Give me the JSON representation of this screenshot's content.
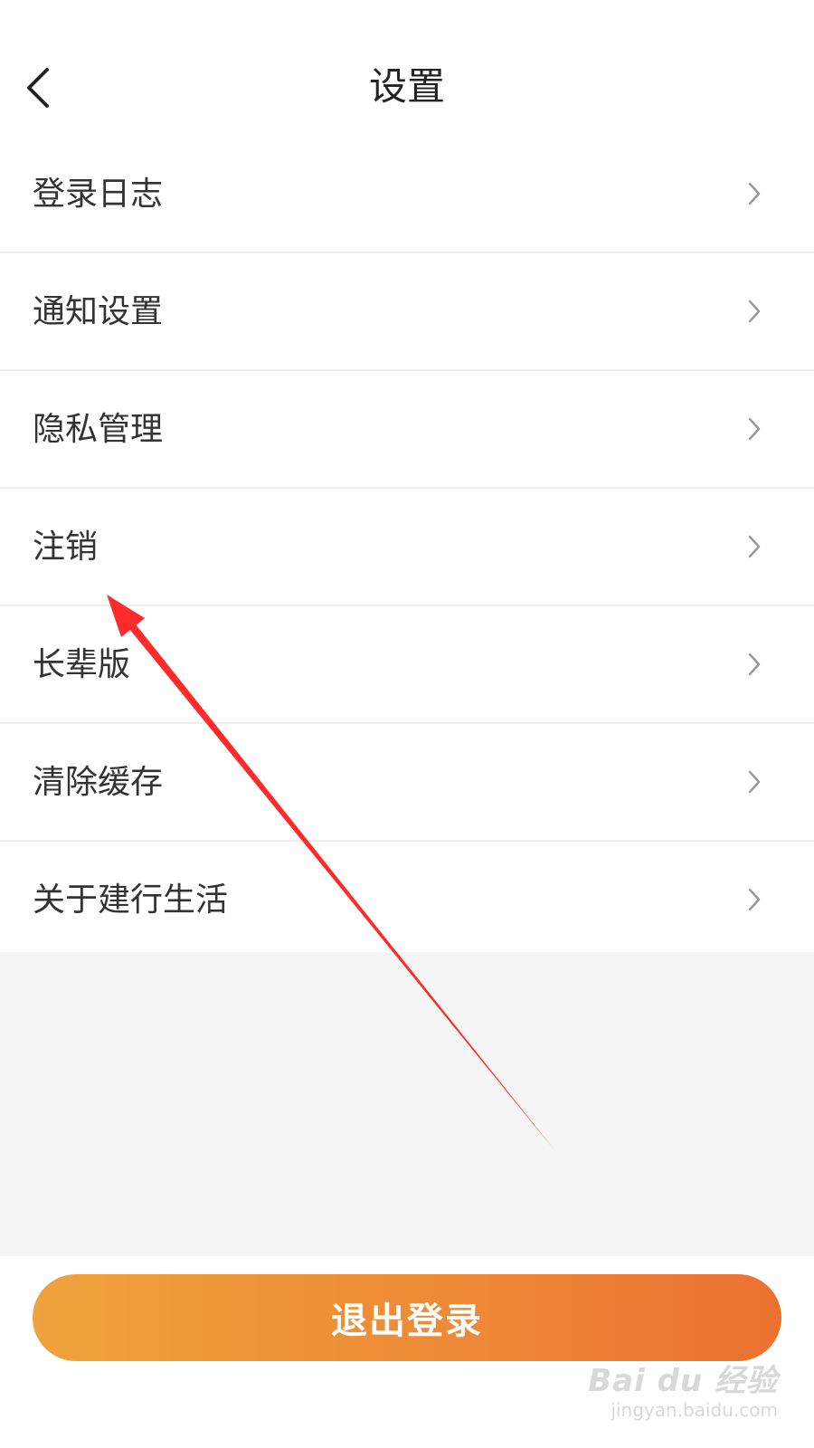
{
  "header": {
    "title": "设置",
    "back_icon": "chevron-left-icon"
  },
  "menu": {
    "items": [
      {
        "label": "登录日志",
        "icon": "chevron-right-icon"
      },
      {
        "label": "通知设置",
        "icon": "chevron-right-icon"
      },
      {
        "label": "隐私管理",
        "icon": "chevron-right-icon"
      },
      {
        "label": "注销",
        "icon": "chevron-right-icon"
      },
      {
        "label": "长辈版",
        "icon": "chevron-right-icon"
      },
      {
        "label": "清除缓存",
        "icon": "chevron-right-icon"
      },
      {
        "label": "关于建行生活",
        "icon": "chevron-right-icon"
      }
    ]
  },
  "logout": {
    "label": "退出登录"
  },
  "watermark": {
    "logo": "Bai du 经验",
    "url": "jingyan.baidu.com"
  },
  "colors": {
    "background": "#ffffff",
    "divider": "#eeeeee",
    "gray_area": "#f5f5f5",
    "button_gradient_start": "#efa33c",
    "button_gradient_end": "#ec7132",
    "annotation_arrow": "#ff2a2a"
  }
}
